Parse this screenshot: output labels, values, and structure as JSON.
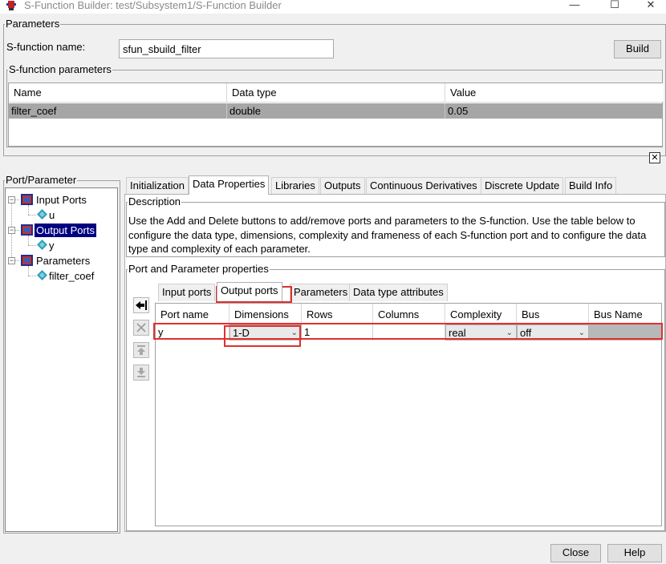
{
  "window": {
    "title": "S-Function Builder: test/Subsystem1/S-Function Builder",
    "minimize_glyph": "—",
    "maximize_glyph": "☐",
    "close_glyph": "✕"
  },
  "parameters": {
    "group_label": "Parameters",
    "name_label": "S-function name:",
    "name_value": "sfun_sbuild_filter",
    "build_label": "Build",
    "sfun_params": {
      "group_label": "S-function parameters",
      "columns": [
        "Name",
        "Data type",
        "Value"
      ],
      "rows": [
        [
          "filter_coef",
          "double",
          "0.05"
        ]
      ]
    },
    "close_x": "✕"
  },
  "tree": {
    "group_label": "Port/Parameter",
    "items": [
      {
        "label": "Input Ports",
        "icon": "input-ports-icon"
      },
      {
        "label": "u",
        "icon": "port-diamond-icon"
      },
      {
        "label": "Output Ports",
        "icon": "output-ports-icon"
      },
      {
        "label": "y",
        "icon": "port-diamond-icon"
      },
      {
        "label": "Parameters",
        "icon": "parameters-icon"
      },
      {
        "label": "filter_coef",
        "icon": "port-diamond-icon"
      }
    ],
    "expander_glyph": "−"
  },
  "tabs": [
    "Initialization",
    "Data Properties",
    "Libraries",
    "Outputs",
    "Continuous Derivatives",
    "Discrete Update",
    "Build Info"
  ],
  "description": {
    "group_label": "Description",
    "text": "Use the Add and Delete buttons to add/remove ports and parameters to the S-function. Use the table below to configure the data type, dimensions, complexity and frameness of each S-function port and to configure the data type and complexity of each parameter."
  },
  "port_props": {
    "group_label": "Port and Parameter properties",
    "subtabs": [
      "Input ports",
      "Output ports",
      "Parameters",
      "Data type attributes"
    ],
    "columns": [
      "Port name",
      "Dimensions",
      "Rows",
      "Columns",
      "Complexity",
      "Bus",
      "Bus Name"
    ],
    "row": {
      "port_name": "y",
      "dimensions": "1-D",
      "rows": "1",
      "columns": "",
      "complexity": "real",
      "bus": "off",
      "bus_name": ""
    }
  },
  "footer": {
    "close_label": "Close",
    "help_label": "Help"
  },
  "colors": {
    "selection": "#000080",
    "row_highlight": "#a6a6a6",
    "annotation_red": "#e03030"
  }
}
